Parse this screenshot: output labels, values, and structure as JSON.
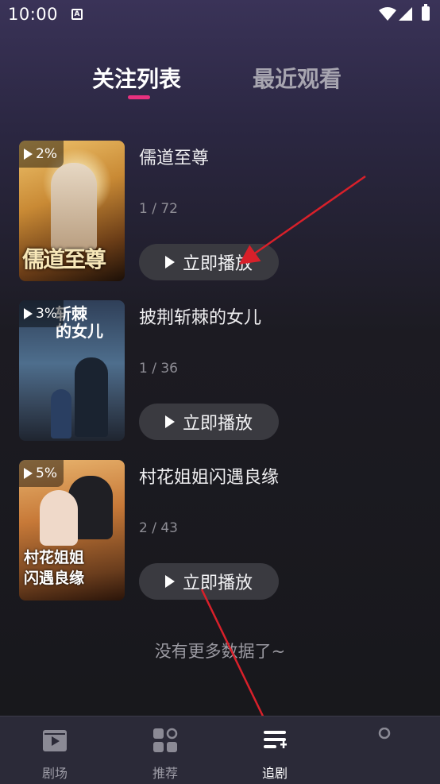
{
  "status_bar": {
    "time": "10:00",
    "notification": "A"
  },
  "tabs": [
    {
      "label": "关注列表",
      "active": true
    },
    {
      "label": "最近观看",
      "active": false
    }
  ],
  "shows": [
    {
      "title": "儒道至尊",
      "progress": "2%",
      "episodes": "1 / 72",
      "play_label": "立即播放",
      "poster_text": "儒道至尊"
    },
    {
      "title": "披荆斩棘的女儿",
      "progress": "3%",
      "episodes": "1 / 36",
      "play_label": "立即播放",
      "poster_text": "斩棘\n的女儿"
    },
    {
      "title": "村花姐姐闪遇良缘",
      "progress": "5%",
      "episodes": "2 / 43",
      "play_label": "立即播放",
      "poster_text": "村花姐姐\n闪遇良缘"
    }
  ],
  "no_more_text": "没有更多数据了~",
  "bottom_nav": [
    {
      "label": "剧场",
      "icon": "theater-icon",
      "active": false
    },
    {
      "label": "推荐",
      "icon": "grid-icon",
      "active": false
    },
    {
      "label": "追剧",
      "icon": "playlist-add-icon",
      "active": true
    },
    {
      "label": "",
      "icon": "profile-icon",
      "active": false
    }
  ],
  "colors": {
    "accent": "#e8317f",
    "arrow": "#d8202a"
  }
}
